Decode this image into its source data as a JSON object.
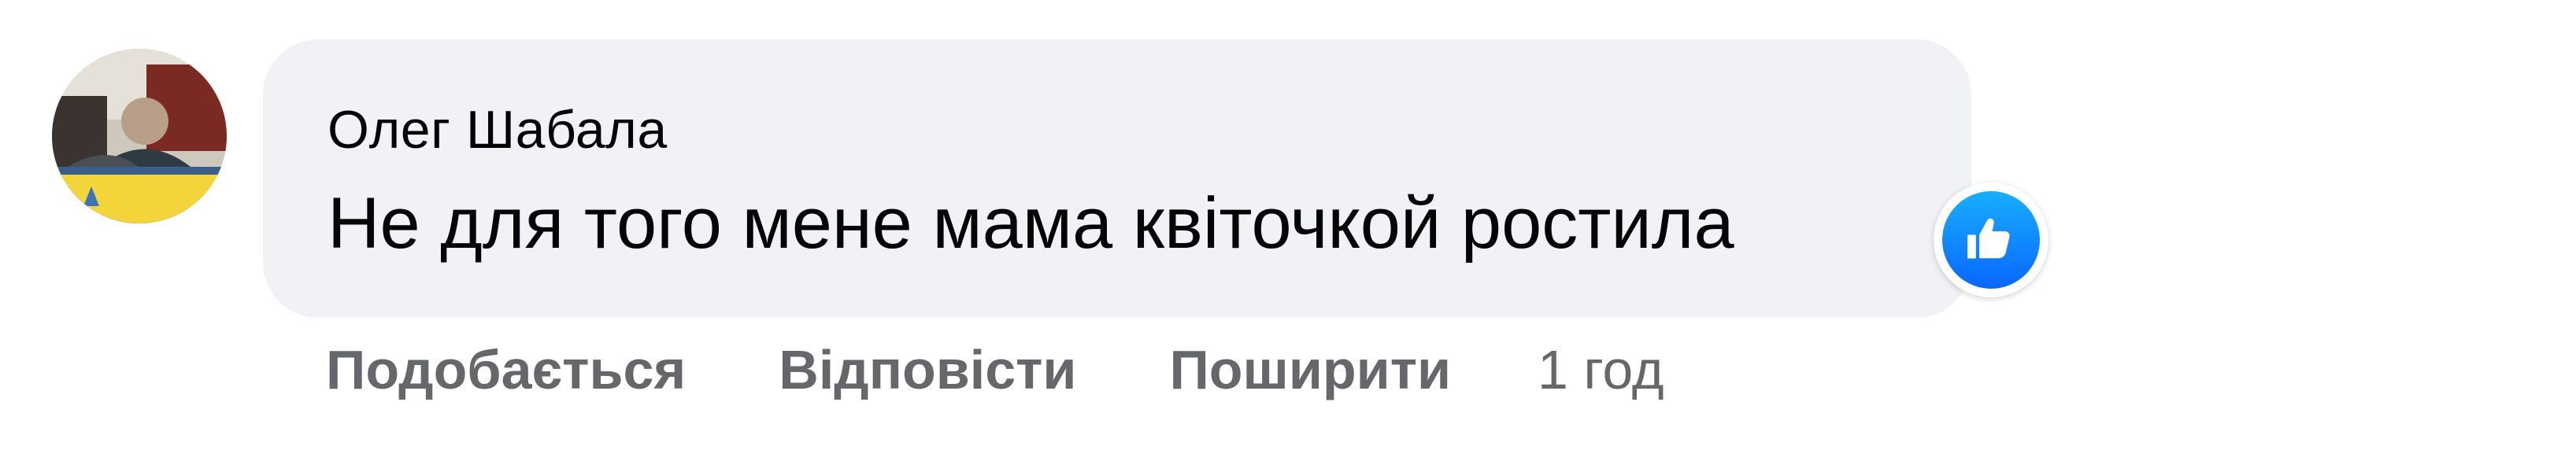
{
  "comment": {
    "author": "Олег Шабала",
    "text": "Не для того мене мама квіточкой ростила",
    "reaction_icon": "like-icon",
    "reaction_color": "#0866ff"
  },
  "actions": {
    "like_label": "Подобається",
    "reply_label": "Відповісти",
    "share_label": "Поширити",
    "timestamp": "1 год"
  },
  "colors": {
    "bubble": "#f0f2f5",
    "text": "#050505",
    "secondary_text": "#65676b"
  }
}
